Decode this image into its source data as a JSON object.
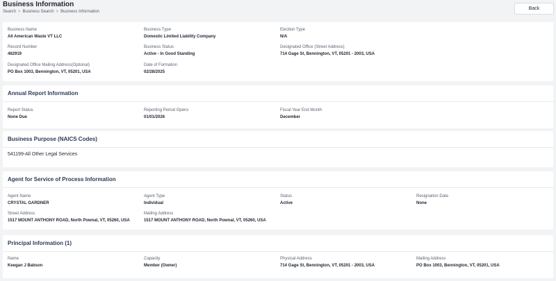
{
  "page": {
    "title": "Business Information",
    "back_label": "Back",
    "breadcrumb": [
      "Search",
      "Business Search",
      "Business Information"
    ],
    "breadcrumb_sep": ">"
  },
  "business": {
    "name_label": "Business Name",
    "name": "All American Waste VT LLC",
    "type_label": "Business Type",
    "type": "Domestic Limited Liability Company",
    "election_label": "Election Type",
    "election": "N/A",
    "record_label": "Record Number",
    "record": "462919",
    "status_label": "Business Status",
    "status": "Active - In Good Standing",
    "office_label": "Designated Office (Street Address)",
    "office": "714 Gage St, Bennington, VT, 05201 - 2003, USA",
    "mailing_label": "Designated Office Mailing Address(Optional)",
    "mailing": "PO Box 1003, Bennington, VT, 05201, USA",
    "formation_label": "Date of Formation",
    "formation": "02/28/2025"
  },
  "annual": {
    "title": "Annual Report Information",
    "status_label": "Report Status",
    "status": "None Due",
    "period_label": "Reporting Period Opens",
    "period": "01/01/2026",
    "fiscal_label": "Fiscal Year End Month",
    "fiscal": "December"
  },
  "purpose": {
    "title": "Business Purpose (NAICS Codes)",
    "text": "541199-All Other Legal Services"
  },
  "agent": {
    "title": "Agent for Service of Process Information",
    "name_label": "Agent Name",
    "name": "CRYSTAL GARDNER",
    "type_label": "Agent Type",
    "type": "Individual",
    "status_label": "Status",
    "status": "Active",
    "resign_label": "Resignation Date",
    "resign": "None",
    "street_label": "Street Address",
    "street": "1517 MOUNT ANTHONY ROAD, North Pownal, VT, 05260, USA",
    "mailing_label": "Mailing Address",
    "mailing": "1517 MOUNT ANTHONY ROAD, North Pownal, VT, 05260, USA"
  },
  "principal": {
    "title": "Principal Information (1)",
    "name_label": "Name",
    "name": "Keegan J Babson",
    "capacity_label": "Capacity",
    "capacity": "Member (Owner)",
    "physical_label": "Physical Address",
    "physical": "714 Gage St, Bennington, VT, 05201 - 2003, USA",
    "mailing_label": "Mailing Address",
    "mailing": "PO Box 1003, Bennington, VT, 05201, USA"
  }
}
